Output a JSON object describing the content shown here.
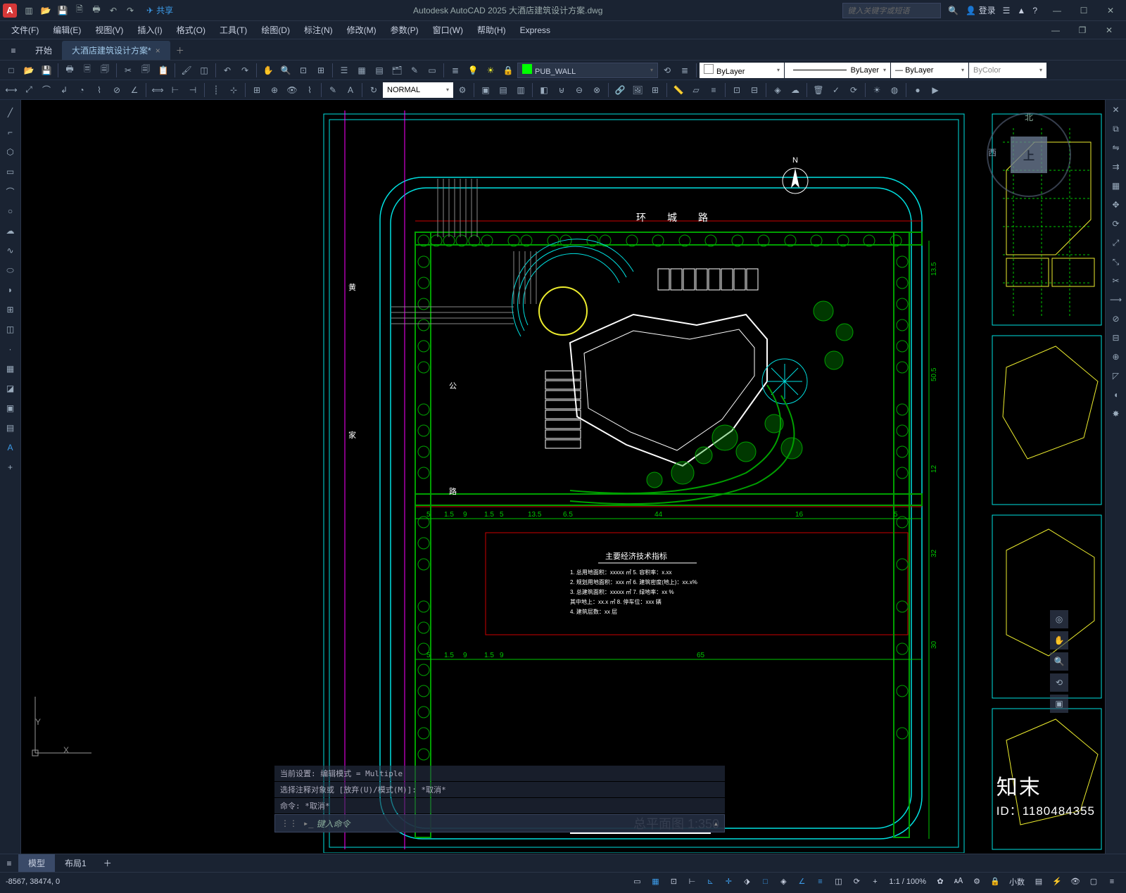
{
  "app": {
    "letter": "A",
    "titleCenter": "Autodesk AutoCAD 2025    大酒店建筑设计方案.dwg",
    "searchPlaceholder": "键入关键字或短语",
    "login": "登录"
  },
  "menubar": [
    "文件(F)",
    "编辑(E)",
    "视图(V)",
    "插入(I)",
    "格式(O)",
    "工具(T)",
    "绘图(D)",
    "标注(N)",
    "修改(M)",
    "参数(P)",
    "窗口(W)",
    "帮助(H)",
    "Express"
  ],
  "tabs": {
    "start": "开始",
    "file": "大酒店建筑设计方案*"
  },
  "layers": {
    "current": "PUB_WALL",
    "colorProp": "ByLayer",
    "linetypeProp": "ByLayer",
    "lineweightProp": "ByLayer",
    "plotProp": "ByColor"
  },
  "dimstyle": "NORMAL",
  "share": "共享",
  "viewcube": {
    "top": "上",
    "north": "北",
    "west": "西"
  },
  "command": {
    "hist1": "当前设置: 编辑模式 = Multiple",
    "hist2": "选择注释对象或 [放弃(U)/模式(M)]: *取消*",
    "hist3": "命令: *取消*",
    "promptLabel": "命令:",
    "prompt": "键入命令"
  },
  "ucs": {
    "x": "X",
    "y": "Y"
  },
  "drawing": {
    "title": "总平面图 1:350",
    "roadTop": "环        城        路",
    "indexTitle": "主要经济技术指标",
    "dimsH": [
      "5",
      "1.5",
      "9",
      "1.5",
      "5",
      "13.5",
      "6.5",
      "44",
      "16",
      "5"
    ],
    "dimsH2": [
      "5",
      "1.5",
      "9",
      "1.5",
      "9",
      "65"
    ],
    "dimsV": [
      "13.5",
      "50.5",
      "12",
      "32",
      "30"
    ]
  },
  "layoutTabs": {
    "model": "模型",
    "layout1": "布局1"
  },
  "status": {
    "coords": "-8567, 38474, 0",
    "scale": "1:1 / 100%",
    "decimal": "小数"
  },
  "watermark": {
    "logo": "知末",
    "id": "ID：1180484355"
  }
}
